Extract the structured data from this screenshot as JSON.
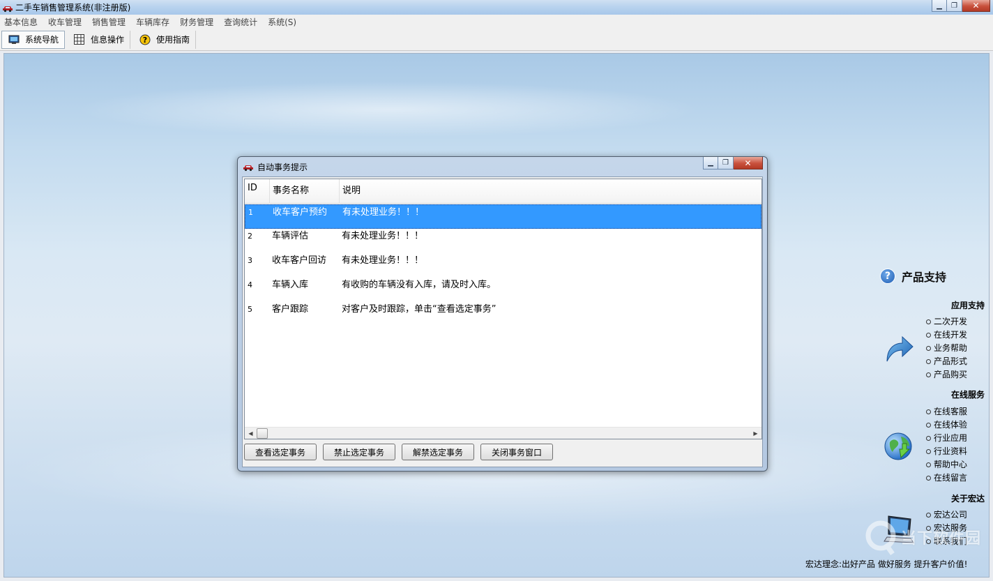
{
  "window": {
    "title": "二手车销售管理系统(非注册版)",
    "buttons": {
      "minimize": "▁",
      "maximize": "❐",
      "close": "✕"
    }
  },
  "menu": [
    "基本信息",
    "收车管理",
    "销售管理",
    "车辆库存",
    "财务管理",
    "查询统计",
    "系统(S)"
  ],
  "toolbar": {
    "items": [
      {
        "label": "系统导航",
        "icon": "monitor-icon"
      },
      {
        "label": "信息操作",
        "icon": "grid-icon"
      },
      {
        "label": "使用指南",
        "icon": "help-icon"
      }
    ]
  },
  "dialog": {
    "title": "自动事务提示",
    "columns": [
      "ID",
      "事务名称",
      "说明"
    ],
    "rows": [
      {
        "id": "1",
        "name": "收车客户预约",
        "desc": "有未处理业务！！！",
        "selected": true
      },
      {
        "id": "2",
        "name": "车辆评估",
        "desc": "有未处理业务！！！"
      },
      {
        "id": "3",
        "name": "收车客户回访",
        "desc": "有未处理业务！！！"
      },
      {
        "id": "4",
        "name": "车辆入库",
        "desc": "有收购的车辆没有入库，请及时入库。"
      },
      {
        "id": "5",
        "name": "客户跟踪",
        "desc": "对客户及时跟踪，单击“查看选定事务”"
      }
    ],
    "buttons": {
      "view": "查看选定事务",
      "disable": "禁止选定事务",
      "enable": "解禁选定事务",
      "close": "关闭事务窗口"
    }
  },
  "side_panel": {
    "title": "产品支持",
    "sections": [
      {
        "title": "应用支持",
        "icon": "arrow-icon",
        "links": [
          "二次开发",
          "在线开发",
          "业务帮助",
          "产品形式",
          "产品购买"
        ]
      },
      {
        "title": "在线服务",
        "icon": "globe-icon",
        "links": [
          "在线客服",
          "在线体验",
          "行业应用",
          "行业资料",
          "帮助中心",
          "在线留言"
        ]
      },
      {
        "title": "关于宏达",
        "icon": "computer-icon",
        "links": [
          "宏达公司",
          "宏达服务",
          "联系我们"
        ]
      }
    ]
  },
  "footer": "宏达理念:出好产品 做好服务 提升客户价值!",
  "watermark": "当下软件园"
}
